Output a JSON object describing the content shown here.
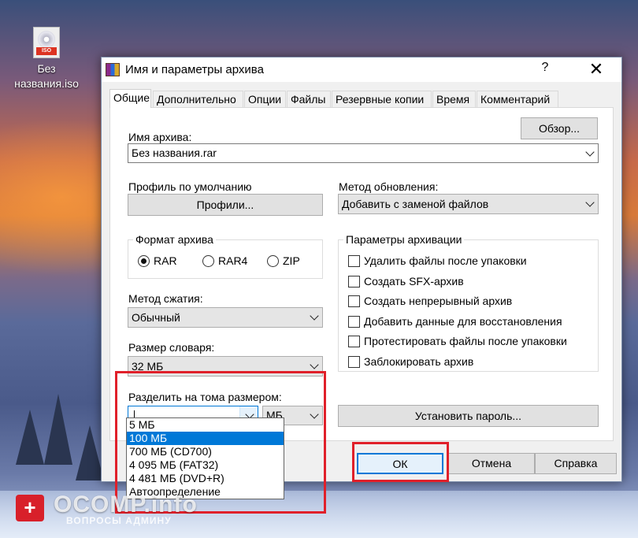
{
  "desktop": {
    "icon_label": "Без названия.iso",
    "icon_tag": "ISO"
  },
  "window": {
    "title": "Имя и параметры архива",
    "help_glyph": "?",
    "close_glyph": "✕"
  },
  "tabs": [
    "Общие",
    "Дополнительно",
    "Опции",
    "Файлы",
    "Резервные копии",
    "Время",
    "Комментарий"
  ],
  "general": {
    "archive_name_label": "Имя архива:",
    "browse_button": "Обзор...",
    "archive_name_value": "Без названия.rar",
    "default_profile_label": "Профиль по умолчанию",
    "profiles_button": "Профили...",
    "update_method_label": "Метод обновления:",
    "update_method_value": "Добавить с заменой файлов",
    "format_group_title": "Формат архива",
    "formats": [
      {
        "label": "RAR",
        "selected": true
      },
      {
        "label": "RAR4",
        "selected": false
      },
      {
        "label": "ZIP",
        "selected": false
      }
    ],
    "archiving_options_title": "Параметры архивации",
    "archiving_options": [
      {
        "label": "Удалить файлы после упаковки",
        "checked": false
      },
      {
        "label": "Создать SFX-архив",
        "checked": false
      },
      {
        "label": "Создать непрерывный архив",
        "checked": false
      },
      {
        "label": "Добавить данные для восстановления",
        "checked": false
      },
      {
        "label": "Протестировать файлы после упаковки",
        "checked": false
      },
      {
        "label": "Заблокировать архив",
        "checked": false
      }
    ],
    "compression_label": "Метод сжатия:",
    "compression_value": "Обычный",
    "dictionary_label": "Размер словаря:",
    "dictionary_value": "32 МБ",
    "split_label": "Разделить на тома размером:",
    "split_value": "",
    "split_unit": "МБ",
    "set_password_button": "Установить пароль...",
    "split_options": [
      "5 МБ",
      "100 МБ",
      "700 МБ  (CD700)",
      "4 095 МБ  (FAT32)",
      "4 481 МБ  (DVD+R)",
      "Автоопределение"
    ],
    "split_selected_index": 1
  },
  "footer": {
    "ok": "ОК",
    "cancel": "Отмена",
    "help": "Справка"
  },
  "watermark": {
    "badge": "+",
    "site": "OCOMP.info",
    "sub": "ВОПРОСЫ АДМИНУ"
  },
  "colors": {
    "highlight": "#e0202a",
    "selection": "#0078d7"
  }
}
